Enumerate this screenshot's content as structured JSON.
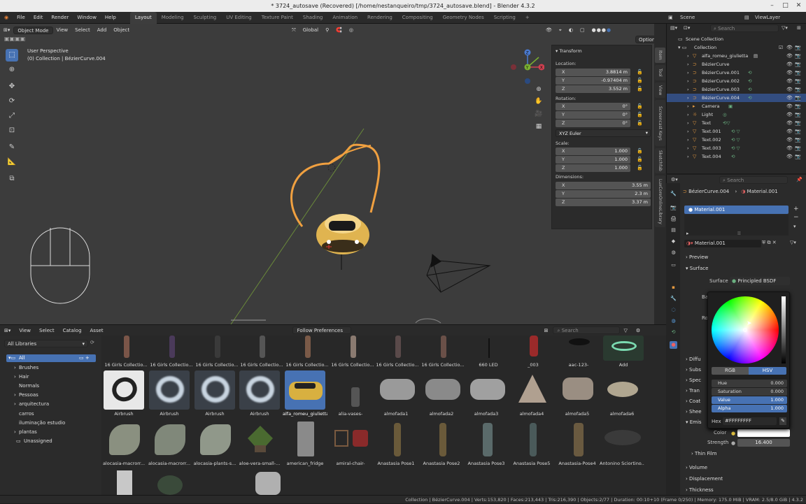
{
  "window": {
    "title": "* 3724_autosave (Recovered) [/home/nestanqueiro/tmp/3724_autosave.blend] - Blender 4.3.2"
  },
  "menu": [
    "File",
    "Edit",
    "Render",
    "Window",
    "Help"
  ],
  "workspace_tabs": [
    "Layout",
    "Modeling",
    "Sculpting",
    "UV Editing",
    "Texture Paint",
    "Shading",
    "Animation",
    "Rendering",
    "Compositing",
    "Geometry Nodes",
    "Scripting"
  ],
  "active_tab": "Layout",
  "top_right": {
    "scene": "Scene",
    "viewlayer": "ViewLayer"
  },
  "viewport": {
    "mode": "Object Mode",
    "menus": [
      "View",
      "Select",
      "Add",
      "Object"
    ],
    "transform_orientation": "Global",
    "info_line1": "User Perspective",
    "info_line2": "(0) Collection | BézierCurve.004",
    "options": "Options",
    "gizmo": {
      "x": "X",
      "y": "Y",
      "z": "Z"
    }
  },
  "npanel": {
    "header": "Transform",
    "location_label": "Location:",
    "location": [
      {
        "axis": "X",
        "value": "3.8814 m"
      },
      {
        "axis": "Y",
        "value": "-0.97404 m"
      },
      {
        "axis": "Z",
        "value": "3.552 m"
      }
    ],
    "rotation_label": "Rotation:",
    "rotation": [
      {
        "axis": "X",
        "value": "0°"
      },
      {
        "axis": "Y",
        "value": "0°"
      },
      {
        "axis": "Z",
        "value": "0°"
      }
    ],
    "rotation_mode": "XYZ Euler",
    "scale_label": "Scale:",
    "scale": [
      {
        "axis": "X",
        "value": "1.000"
      },
      {
        "axis": "Y",
        "value": "1.000"
      },
      {
        "axis": "Z",
        "value": "1.000"
      }
    ],
    "dimensions_label": "Dimensions:",
    "dimensions": [
      {
        "axis": "X",
        "value": "3.55 m"
      },
      {
        "axis": "Y",
        "value": "2.3 m"
      },
      {
        "axis": "Z",
        "value": "3.37 m"
      }
    ]
  },
  "sidetabs": [
    "Item",
    "Tool",
    "View",
    "Screencast Keys",
    "Sketchfab",
    "LuxCoreOnlineLibrary"
  ],
  "asset_browser": {
    "menus": [
      "View",
      "Select",
      "Catalog",
      "Asset"
    ],
    "import_method": "Follow Preferences",
    "search_placeholder": "Search",
    "library": "All Libraries",
    "tree": [
      "All",
      "Brushes",
      "Hair",
      "Normals",
      "Pessoas",
      "arquitectura",
      "carros",
      "iluminação estudio",
      "plantas",
      "Unassigned"
    ],
    "row1": [
      "16 Girls Collectio...",
      "16 Girls Collectio...",
      "16 Girls Collectio...",
      "16 Girls Collectio...",
      "16 Girls Collectio...",
      "16 Girls Collectio...",
      "16 Girls Collectio...",
      "16 Girls Collectio...",
      "660 LED",
      "_003",
      "aac-123-",
      "Add"
    ],
    "row2": [
      "Airbrush",
      "Airbrush",
      "Airbrush",
      "Airbrush",
      "alfa_romeu_giulietta",
      "alia-vases-",
      "almofada1",
      "almofada2",
      "almofada3",
      "almofada4",
      "almofada5",
      "almofada6"
    ],
    "row3": [
      "alocasia-macrorr...",
      "alocasia-macrorr...",
      "alocasia-plants-s...",
      "aloe-vera-small-...",
      "american_fridge",
      "amiral-chair-",
      "Anastasia Pose1",
      "Anastasia Pose2",
      "Anastasia Pose3",
      "Anastasia Pose5",
      "Anastasia-Pose4",
      "Antonino Sciortino..."
    ]
  },
  "outliner": {
    "search_placeholder": "Search",
    "items": [
      "Scene Collection",
      "Collection",
      "alfa_romeu_giulietta",
      "BézierCurve",
      "BézierCurve.001",
      "BézierCurve.002",
      "BézierCurve.003",
      "BézierCurve.004",
      "Camera",
      "Light",
      "Text",
      "Text.001",
      "Text.002",
      "Text.003",
      "Text.004"
    ],
    "selected": "BézierCurve.004"
  },
  "properties": {
    "search_placeholder": "Search",
    "breadcrumb_object": "BézierCurve.004",
    "breadcrumb_material": "Material.001",
    "slot": "Material.001",
    "material_name": "Material.001",
    "sections": {
      "preview": "Preview",
      "surface": "Surface",
      "volume": "Volume",
      "displacement": "Displacement",
      "thickness": "Thickness",
      "thin_film": "Thin Film"
    },
    "surface_label": "Surface",
    "surface_value": "Principled BSDF",
    "hidden_labels": [
      "Ba",
      "Ro",
      "Diffu",
      "Subs",
      "Spec",
      "Tran",
      "Coat",
      "Shee",
      "Emis"
    ],
    "color_label": "Color",
    "strength_label": "Strength",
    "strength_value": "16.400"
  },
  "color_picker": {
    "mode_rgb": "RGB",
    "mode_hsv": "HSV",
    "hue_label": "Hue",
    "hue": "0.000",
    "sat_label": "Saturation",
    "sat": "0.000",
    "value_label": "Value",
    "value": "1.000",
    "alpha_label": "Alpha",
    "alpha": "1.000",
    "hex_label": "Hex",
    "hex": "#FFFFFFFF"
  },
  "statusbar": "Collection | BézierCurve.004 | Verts:153,820 | Faces:213,443 | Tris:216,390 | Objects:2/77 | Duration: 00:10+10 (Frame 0/250) | Memory: 175.0 MiB | VRAM: 2.5/8.0 GiB | 4.3.2",
  "colors": {
    "accent": "#4772b3",
    "curve": "#f0a040",
    "car": "#e8c060",
    "selected_row": "#334d80"
  }
}
